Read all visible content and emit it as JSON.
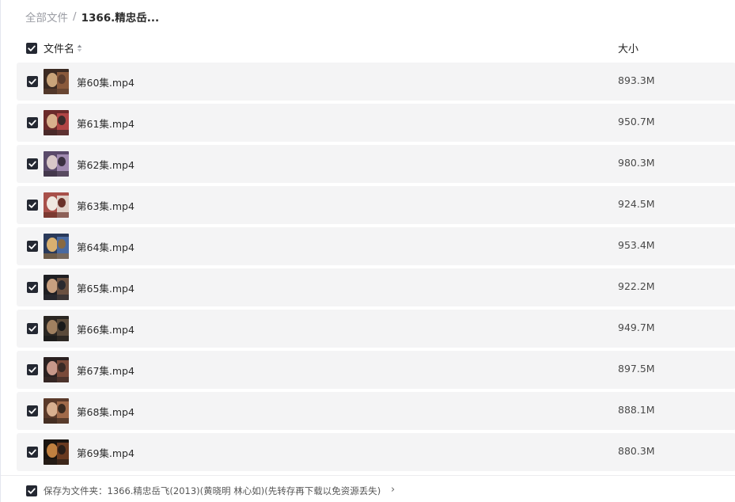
{
  "breadcrumb": {
    "root": "全部文件",
    "separator": "/",
    "current": "1366.精忠岳..."
  },
  "table": {
    "col_name": "文件名",
    "col_size": "大小",
    "all_checked": true
  },
  "files": [
    {
      "name": "第60集.mp4",
      "size": "893.3M",
      "checked": true
    },
    {
      "name": "第61集.mp4",
      "size": "950.7M",
      "checked": true
    },
    {
      "name": "第62集.mp4",
      "size": "980.3M",
      "checked": true
    },
    {
      "name": "第63集.mp4",
      "size": "924.5M",
      "checked": true
    },
    {
      "name": "第64集.mp4",
      "size": "953.4M",
      "checked": true
    },
    {
      "name": "第65集.mp4",
      "size": "922.2M",
      "checked": true
    },
    {
      "name": "第66集.mp4",
      "size": "949.7M",
      "checked": true
    },
    {
      "name": "第67集.mp4",
      "size": "897.5M",
      "checked": true
    },
    {
      "name": "第68集.mp4",
      "size": "888.1M",
      "checked": true
    },
    {
      "name": "第69集.mp4",
      "size": "880.3M",
      "checked": true
    }
  ],
  "footer": {
    "save_path": "保存为文件夹：1366.精忠岳飞(2013)(黄晓明 林心如)(先转存再下载以免资源丢失)",
    "chevron": "›",
    "checked": true
  },
  "colors": {
    "checkbox": "#242832",
    "row_bg": "#f4f4f5",
    "muted_text": "#9a9ca3"
  },
  "icons": {
    "checkbox": "checkmark-icon",
    "sort": "sort-icon",
    "thumbnail": "video-thumbnail"
  }
}
